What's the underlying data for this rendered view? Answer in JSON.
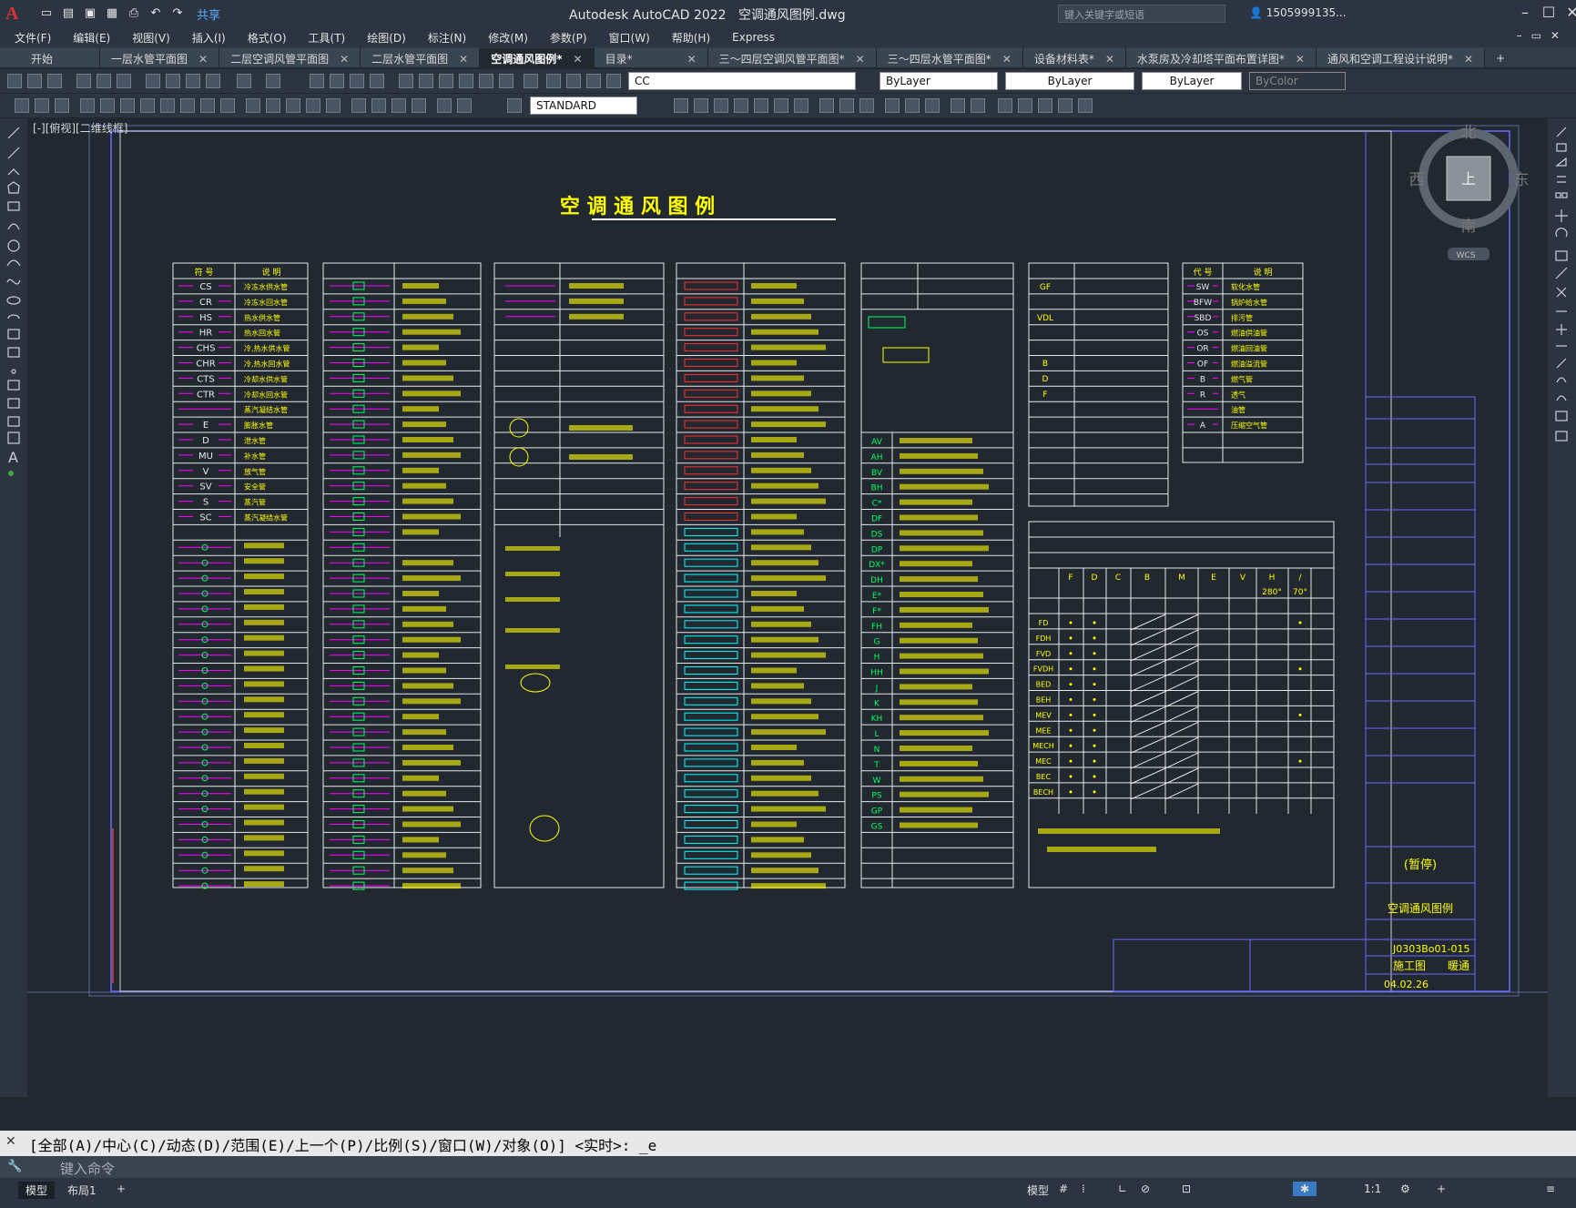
{
  "app": {
    "title": "Autodesk AutoCAD 2022",
    "filename": "空调通风图例.dwg",
    "share": "共享",
    "search_placeholder": "键入关键字或短语",
    "user": "1505999135..."
  },
  "menu": [
    "文件(F)",
    "编辑(E)",
    "视图(V)",
    "插入(I)",
    "格式(O)",
    "工具(T)",
    "绘图(D)",
    "标注(N)",
    "修改(M)",
    "参数(P)",
    "窗口(W)",
    "帮助(H)",
    "Express"
  ],
  "tabs": [
    {
      "label": "开始"
    },
    {
      "label": "一层水管平面图"
    },
    {
      "label": "二层空调风管平面图"
    },
    {
      "label": "二层水管平面图"
    },
    {
      "label": "空调通风图例*",
      "active": true
    },
    {
      "label": "目录*"
    },
    {
      "label": "三～四层空调风管平面图*"
    },
    {
      "label": "三～四层水管平面图*"
    },
    {
      "label": "设备材料表*"
    },
    {
      "label": "水泵房及冷却塔平面布置详图*"
    },
    {
      "label": "通风和空调工程设计说明*"
    }
  ],
  "toolbar": {
    "layer": "CC",
    "bylayer1": "ByLayer",
    "bylayer2": "ByLayer",
    "bylayer3": "ByLayer",
    "bycolor": "ByColor",
    "textstyle": "STANDARD"
  },
  "viewport_label": "[-][俯视][二维线框]",
  "viewcube": {
    "n": "北",
    "s": "南",
    "e": "东",
    "w": "西",
    "top": "上",
    "wcs": "WCS"
  },
  "drawing": {
    "title": "空 调 通 风 图 例",
    "table1": {
      "headers": [
        "符 号",
        "说 明"
      ],
      "codes": [
        "CS",
        "CR",
        "HS",
        "HR",
        "CHS",
        "CHR",
        "CTS",
        "CTR",
        "",
        "E",
        "D",
        "MU",
        "V",
        "SV",
        "S",
        "SC"
      ],
      "desc": [
        "冷冻水供水管",
        "冷冻水回水管",
        "热水供水管",
        "热水回水管",
        "冷,热水供水管",
        "冷,热水回水管",
        "冷却水供水管",
        "冷却水回水管",
        "蒸汽凝结水管",
        "膨胀水管",
        "泄水管",
        "补水管",
        "放气管",
        "安全管",
        "蒸汽管",
        "蒸汽凝结水管"
      ]
    },
    "table7": {
      "headers": [
        "代 号",
        "说 明"
      ],
      "codes": [
        "SW",
        "BFW",
        "SBD",
        "OS",
        "OR",
        "OF",
        "B",
        "R",
        "",
        "A"
      ],
      "desc": [
        "软化水管",
        "锅炉给水管",
        "排污管",
        "燃油供油管",
        "燃油回油管",
        "燃油溢流管",
        "燃气管",
        "透气",
        "油管",
        "压缩空气管"
      ]
    },
    "table5_codes": [
      "AV",
      "AH",
      "BV",
      "BH",
      "C*",
      "DF",
      "DS",
      "DP",
      "DX*",
      "DH",
      "E*",
      "F*",
      "FH",
      "G",
      "H",
      "HH",
      "J",
      "K",
      "KH",
      "L",
      "N",
      "T",
      "W",
      "PS",
      "GP",
      "GS"
    ],
    "table6_codes": [
      "FD",
      "FDH",
      "FVD",
      "FVDH",
      "BED",
      "BEH",
      "MEV",
      "MEE",
      "MECH",
      "MEC",
      "BEC",
      "BECH"
    ],
    "table6_headers": [
      "F",
      "D",
      "C",
      "B",
      "M",
      "E",
      "V",
      "H",
      "/"
    ],
    "table6_temps": [
      "280°",
      "70°"
    ],
    "table4_top_codes": [
      "GF",
      "VDL",
      "B",
      "D",
      "F"
    ],
    "titleblock": {
      "project_no": "J0303Bo01-015",
      "stage": "施工图",
      "discipline": "暖通",
      "sheet_name": "空调通风图例",
      "date": "04.02.26",
      "scale": "(暂停)"
    }
  },
  "command": {
    "history": "[全部(A)/中心(C)/动态(D)/范围(E)/上一个(P)/比例(S)/窗口(W)/对象(O)] <实时>: _e",
    "placeholder": "键入命令"
  },
  "status": {
    "model_tab": "模型",
    "layout_tab": "布局1",
    "model_label": "模型",
    "scale": "1:1"
  }
}
